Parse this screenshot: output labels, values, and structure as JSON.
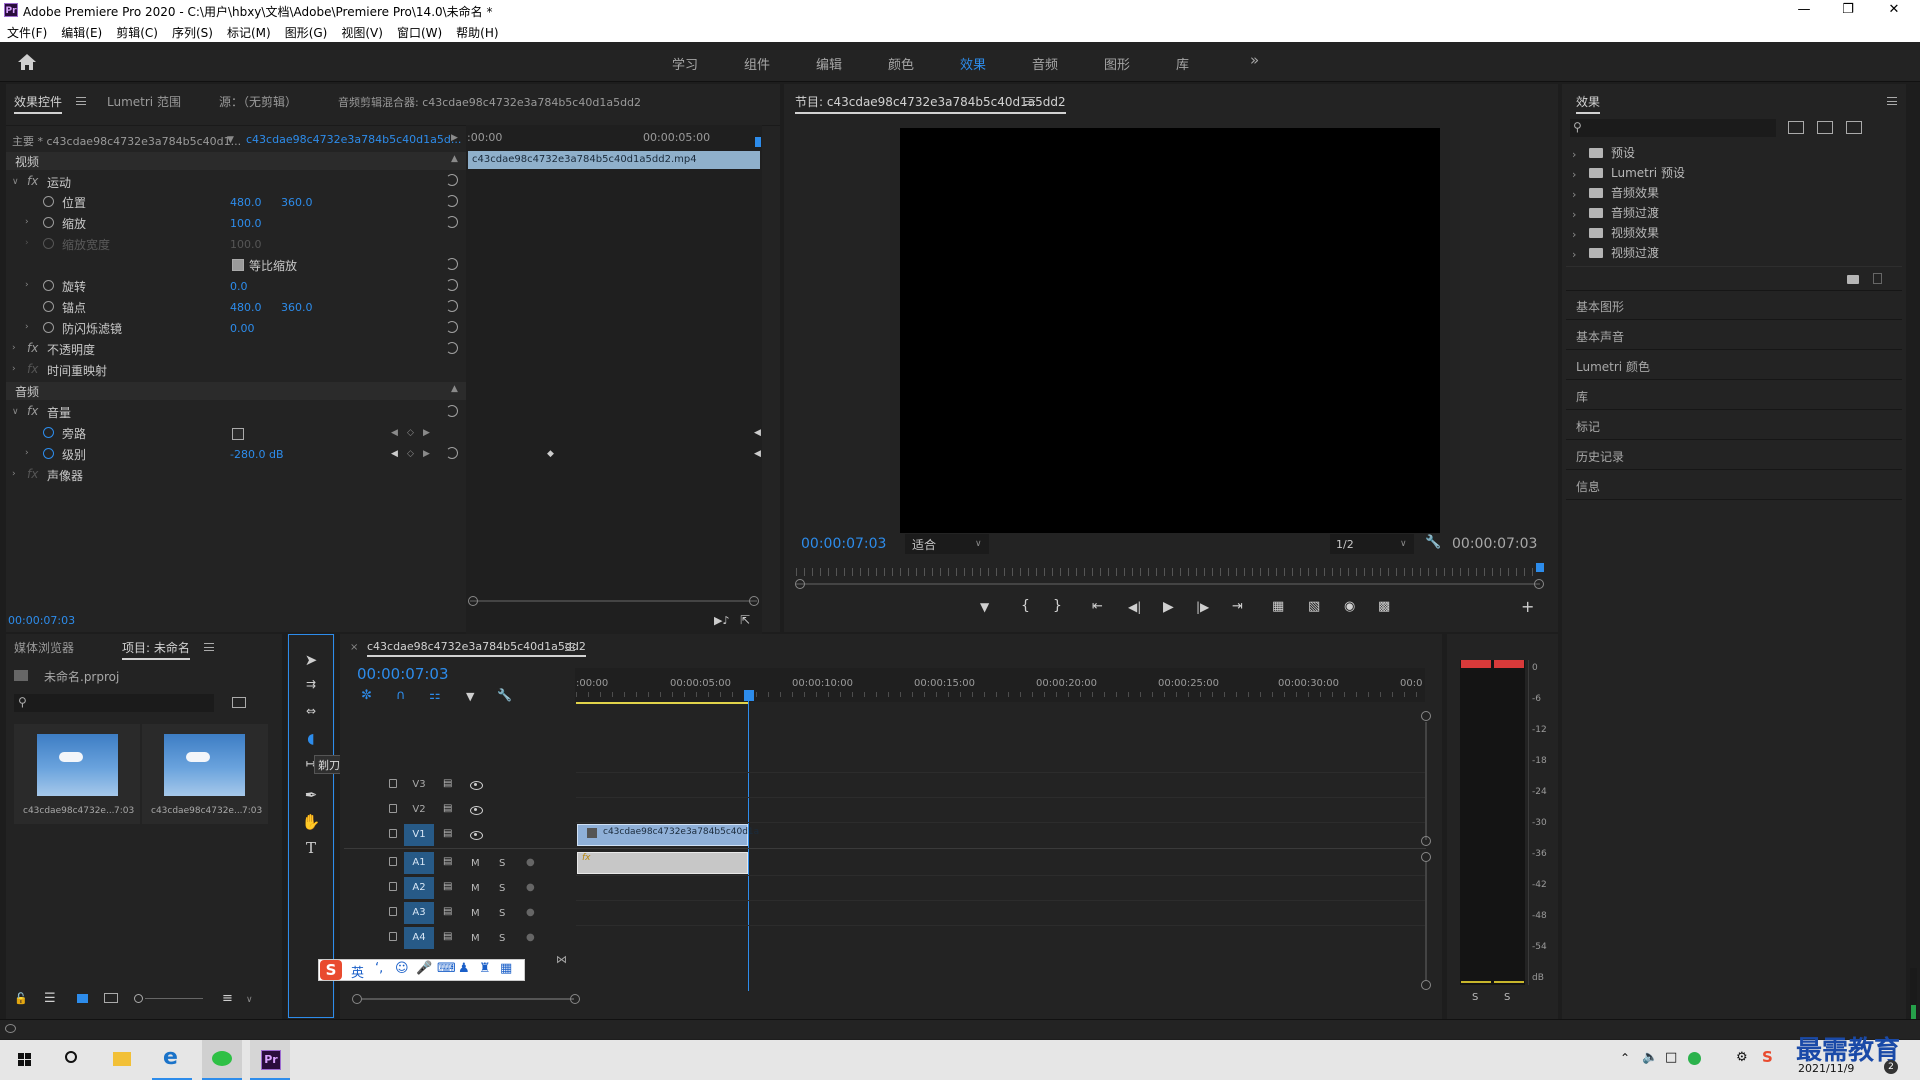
{
  "window": {
    "title": "Adobe Premiere Pro 2020 - C:\\用户\\hbxy\\文档\\Adobe\\Premiere Pro\\14.0\\未命名 *",
    "logo": "Pr"
  },
  "menu": [
    "文件(F)",
    "编辑(E)",
    "剪辑(C)",
    "序列(S)",
    "标记(M)",
    "图形(G)",
    "视图(V)",
    "窗口(W)",
    "帮助(H)"
  ],
  "workspaces": [
    {
      "label": "学习"
    },
    {
      "label": "组件"
    },
    {
      "label": "编辑"
    },
    {
      "label": "颜色"
    },
    {
      "label": "效果",
      "active": true
    },
    {
      "label": "音频"
    },
    {
      "label": "图形"
    },
    {
      "label": "库"
    }
  ],
  "effect_controls": {
    "tabs": [
      "效果控件",
      "Lumetri 范围",
      "源：（无剪辑）",
      "音频剪辑混合器: c43cdae98c4732e3a784b5c40d1a5dd2"
    ],
    "master": "主要 * c43cdae98c4732e3a784b5c40d1...",
    "clip": "c43cdae98c4732e3a784b5c40d1a5d...",
    "ruler_start": ":00:00",
    "ruler_mid": "00:00:05:00",
    "clip_bar": "c43cdae98c4732e3a784b5c40d1a5dd2.mp4",
    "video_section": "视频",
    "motion": "运动",
    "position": {
      "label": "位置",
      "x": "480.0",
      "y": "360.0"
    },
    "scale": {
      "label": "缩放",
      "value": "100.0"
    },
    "scale_width": {
      "label": "缩放宽度",
      "value": "100.0"
    },
    "uniform_scale": "等比缩放",
    "rotation": {
      "label": "旋转",
      "value": "0.0"
    },
    "anchor": {
      "label": "锚点",
      "x": "480.0",
      "y": "360.0"
    },
    "anti_flicker": {
      "label": "防闪烁滤镜",
      "value": "0.00"
    },
    "opacity": "不透明度",
    "time_remap": "时间重映射",
    "audio_section": "音频",
    "volume": "音量",
    "bypass": "旁路",
    "level": {
      "label": "级别",
      "value": "-280.0 dB"
    },
    "panner": "声像器",
    "timecode": "00:00:07:03",
    "fx": "fx"
  },
  "program": {
    "title": "节目: c43cdae98c4732e3a784b5c40d1a5dd2",
    "timecode_left": "00:00:07:03",
    "fit": "适合",
    "resolution": "1/2",
    "timecode_right": "00:00:07:03"
  },
  "effects_panel": {
    "title": "效果",
    "tree": [
      "预设",
      "Lumetri 预设",
      "音频效果",
      "音频过渡",
      "视频效果",
      "视频过渡"
    ],
    "sections": [
      "基本图形",
      "基本声音",
      "Lumetri 颜色",
      "库",
      "标记",
      "历史记录",
      "信息"
    ]
  },
  "project": {
    "tabs": [
      "媒体浏览器",
      "项目: 未命名"
    ],
    "file": "未命名.prproj",
    "items": [
      {
        "name": "c43cdae98c4732e...",
        "duration": "7:03"
      },
      {
        "name": "c43cdae98c4732e...",
        "duration": "7:03"
      }
    ]
  },
  "tools": {
    "tooltip": "剃刀工具 (C)"
  },
  "timeline": {
    "tab": "c43cdae98c4732e3a784b5c40d1a5dd2",
    "timecode": "00:00:07:03",
    "ruler": [
      ":00:00",
      "00:00:05:00",
      "00:00:10:00",
      "00:00:15:00",
      "00:00:20:00",
      "00:00:25:00",
      "00:00:30:00",
      "00:0"
    ],
    "video_tracks": [
      "V3",
      "V2",
      "V1"
    ],
    "audio_tracks": [
      "A1",
      "A2",
      "A3",
      "A4"
    ],
    "clip_label": "c43cdae98c4732e3a784b5c40d1a",
    "fx": "fx",
    "m": "M",
    "s": "S"
  },
  "meter": {
    "ticks": [
      "0",
      "-6",
      "-12",
      "-18",
      "-24",
      "-30",
      "-36",
      "-42",
      "-48",
      "-54",
      "dB"
    ],
    "solo": [
      "S",
      "S"
    ]
  },
  "ime": {
    "lang": "英"
  },
  "taskbar": {
    "date": "2021/11/9",
    "watermark": "最需教育",
    "time_partial": "2"
  }
}
